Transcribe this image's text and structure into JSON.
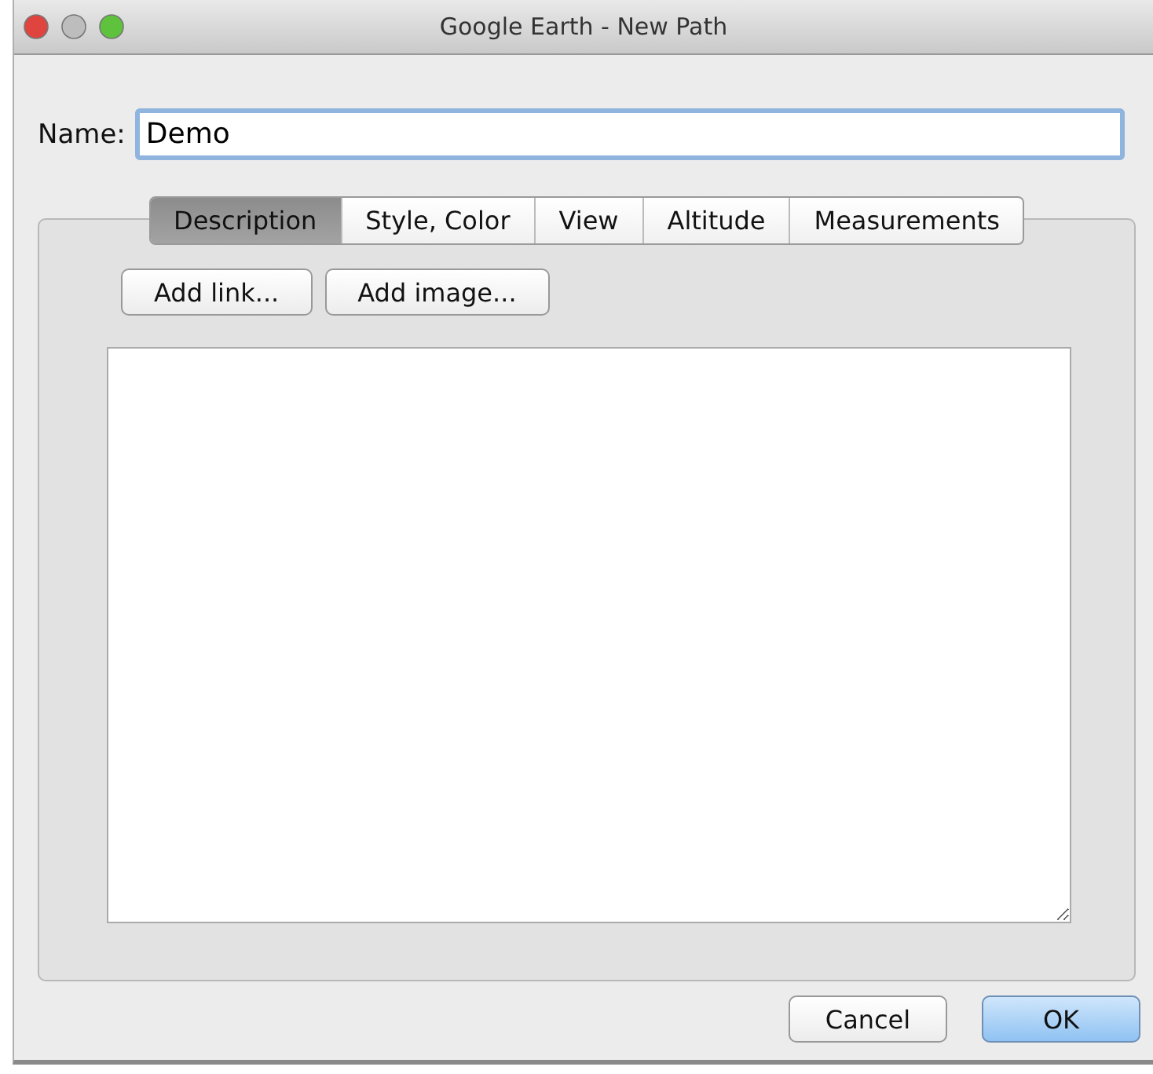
{
  "window": {
    "title": "Google Earth - New Path"
  },
  "name_field": {
    "label": "Name:",
    "value": "Demo"
  },
  "tabs": [
    {
      "label": "Description",
      "selected": true
    },
    {
      "label": "Style, Color",
      "selected": false
    },
    {
      "label": "View",
      "selected": false
    },
    {
      "label": "Altitude",
      "selected": false
    },
    {
      "label": "Measurements",
      "selected": false
    }
  ],
  "description_buttons": [
    "Add link...",
    "Add image..."
  ],
  "buttons": [
    {
      "label": "Cancel",
      "default": false
    },
    {
      "label": "OK",
      "default": true
    }
  ]
}
